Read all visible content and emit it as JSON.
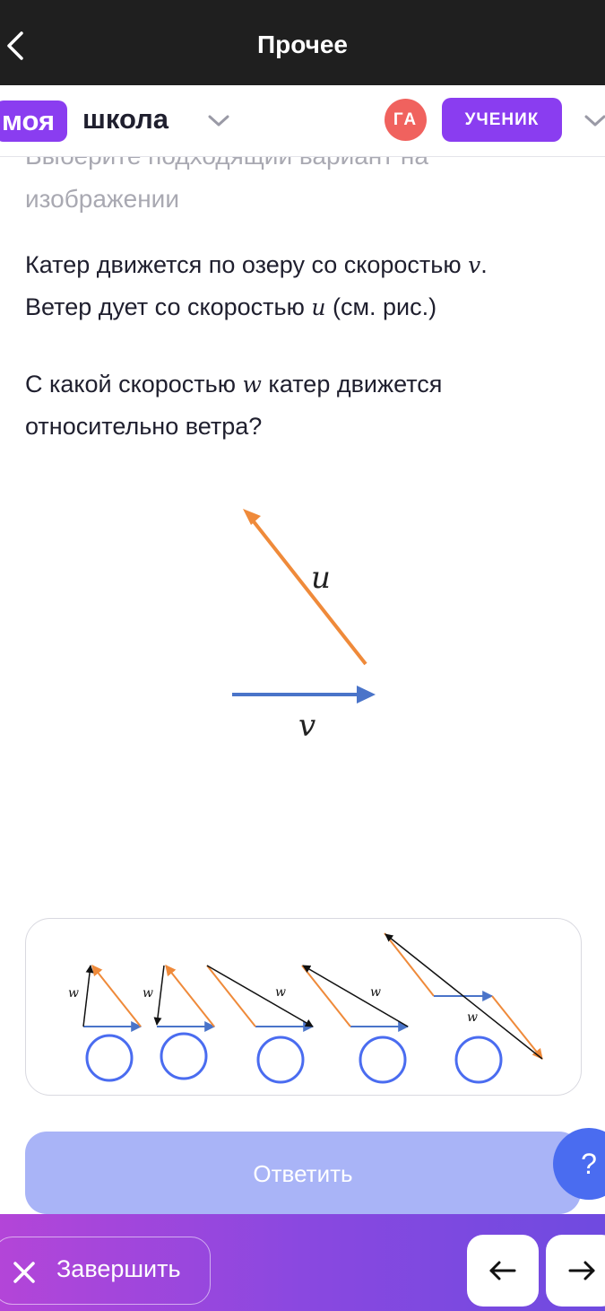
{
  "topbar": {
    "title": "Прочее",
    "back_icon": "chevron-left-icon"
  },
  "header": {
    "logo_part1": "моя",
    "logo_part2": "школа",
    "avatar_initials": "ГА",
    "role_label": "УЧЕНИК"
  },
  "question": {
    "instruction": "Выберите подходящий вариант на изображении",
    "instruction_line1": "Выберите подходящий вариант на",
    "instruction_line2": "изображении",
    "line1_a": "Катер движется по озеру со скоростью ",
    "line1_var": "v",
    "line1_b": ".",
    "line2_a": " Ветер дует со скоростью ",
    "line2_var": "u",
    "line2_b": " (см. рис.)",
    "line3_a": "С какой скоростью ",
    "line3_var": "w",
    "line3_b": " катер движется",
    "line4": "относительно ветра?"
  },
  "figure": {
    "u_label": "u",
    "v_label": "v"
  },
  "options": {
    "w_label": "w",
    "items": [
      {
        "selected": false
      },
      {
        "selected": false
      },
      {
        "selected": false
      },
      {
        "selected": false
      },
      {
        "selected": false
      }
    ]
  },
  "answer_button": "Ответить",
  "help_button": "?",
  "footer": {
    "finish_label": "Завершить"
  },
  "colors": {
    "brand_purple": "#8a3df0",
    "avatar_red": "#f0625e",
    "arrow_orange": "#ef8a3a",
    "arrow_blue": "#4a74c9",
    "radio_blue": "#4a6cf0",
    "answer_disabled": "#a9b4f7"
  }
}
